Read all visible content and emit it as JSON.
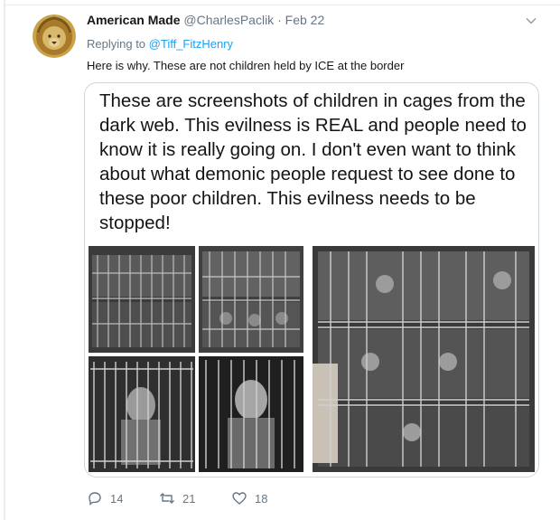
{
  "tweet": {
    "author_name": "American Made",
    "author_handle": "@CharlesPaclik",
    "separator": "·",
    "date": "Feb 22",
    "replying_to_prefix": "Replying to",
    "replying_to_handle": "@Tiff_FitzHenry",
    "text": "Here is why. These are not children held by ICE at the border",
    "media_caption": "These are screenshots of children in cages from the dark web. This evilness is REAL and people need to know it is really going on. I don't even want to think about what demonic people request to see done to these poor children. This evilness needs to be stopped!",
    "actions": {
      "replies": "14",
      "retweets": "21",
      "likes": "18"
    }
  },
  "icons": [
    "lion-avatar",
    "chevron-down-icon",
    "reply-icon",
    "retweet-icon",
    "heart-icon"
  ],
  "colors": {
    "link": "#1da1f2",
    "muted": "#657786",
    "text": "#14171a",
    "border": "#ccd6dd"
  }
}
